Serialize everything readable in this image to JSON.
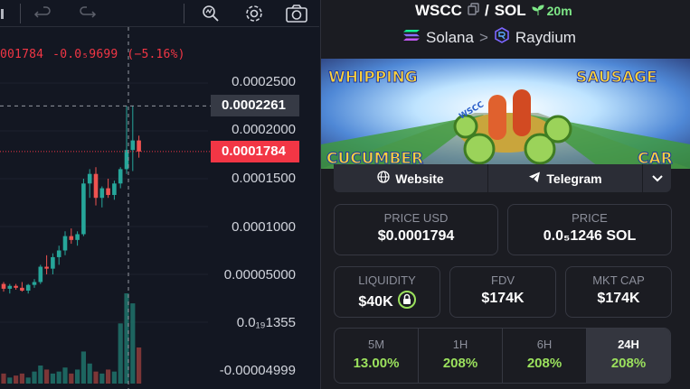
{
  "chart": {
    "toolbar_icons": [
      "bar-chart-icon",
      "undo-icon",
      "redo-icon",
      "magnifier-icon",
      "settings-icon",
      "camera-icon"
    ],
    "price_line": {
      "close": "001784",
      "change": "-0.0₅9699",
      "percent": "(−5.16%)"
    },
    "axis_ticks": [
      "0.0002500",
      "0.0002000",
      "0.0001500",
      "0.0001000",
      "0.00005000",
      "0.0₁₉1355",
      "-0.00004999"
    ],
    "crosshair_value": "0.0002261",
    "current_price": "0.0001784",
    "colors": {
      "up": "#26a69a",
      "down": "#ef5350",
      "current": "#f23645"
    }
  },
  "chart_data": {
    "type": "candlestick",
    "ylim": [
      -4.999e-05,
      0.00025
    ],
    "candles": [
      {
        "o": 4e-05,
        "h": 4.2e-05,
        "l": 3.2e-05,
        "c": 3.5e-05
      },
      {
        "o": 3.5e-05,
        "h": 4e-05,
        "l": 3e-05,
        "c": 3.8e-05
      },
      {
        "o": 3.8e-05,
        "h": 4e-05,
        "l": 3.4e-05,
        "c": 3.6e-05
      },
      {
        "o": 3.6e-05,
        "h": 4.2e-05,
        "l": 3.2e-05,
        "c": 3.3e-05
      },
      {
        "o": 3.3e-05,
        "h": 4e-05,
        "l": 3e-05,
        "c": 3.9e-05
      },
      {
        "o": 3.9e-05,
        "h": 4.5e-05,
        "l": 3.6e-05,
        "c": 4.2e-05
      },
      {
        "o": 4.2e-05,
        "h": 6e-05,
        "l": 4e-05,
        "c": 5.8e-05
      },
      {
        "o": 5.8e-05,
        "h": 7e-05,
        "l": 5e-05,
        "c": 5.6e-05
      },
      {
        "o": 5.6e-05,
        "h": 7.2e-05,
        "l": 5e-05,
        "c": 6.8e-05
      },
      {
        "o": 6.8e-05,
        "h": 8e-05,
        "l": 6e-05,
        "c": 7.5e-05
      },
      {
        "o": 7.5e-05,
        "h": 9.5e-05,
        "l": 7e-05,
        "c": 9e-05
      },
      {
        "o": 9e-05,
        "h": 9.8e-05,
        "l": 8.2e-05,
        "c": 8.6e-05
      },
      {
        "o": 8.6e-05,
        "h": 9.5e-05,
        "l": 8e-05,
        "c": 9.2e-05
      },
      {
        "o": 9.2e-05,
        "h": 0.00015,
        "l": 9e-05,
        "c": 0.000145
      },
      {
        "o": 0.000145,
        "h": 0.00016,
        "l": 0.00013,
        "c": 0.000155
      },
      {
        "o": 0.000155,
        "h": 0.000162,
        "l": 0.000122,
        "c": 0.00013
      },
      {
        "o": 0.00013,
        "h": 0.000142,
        "l": 0.00012,
        "c": 0.00014
      },
      {
        "o": 0.00014,
        "h": 0.00015,
        "l": 0.00013,
        "c": 0.000133
      },
      {
        "o": 0.000133,
        "h": 0.000148,
        "l": 0.000128,
        "c": 0.000145
      },
      {
        "o": 0.000145,
        "h": 0.000162,
        "l": 0.00014,
        "c": 0.00016
      },
      {
        "o": 0.00016,
        "h": 0.0002261,
        "l": 0.000155,
        "c": 0.00018
      },
      {
        "o": 0.00018,
        "h": 0.0002261,
        "l": 0.000158,
        "c": 0.00019
      },
      {
        "o": 0.00019,
        "h": 0.000195,
        "l": 0.000172,
        "c": 0.0001784
      }
    ],
    "volume": [
      5,
      3,
      4,
      5,
      3,
      6,
      9,
      7,
      5,
      6,
      8,
      5,
      7,
      16,
      10,
      6,
      5,
      7,
      6,
      30,
      45,
      40,
      18
    ]
  },
  "pair": {
    "base": "WSCC",
    "slash": "/",
    "quote": "SOL",
    "age": "20m",
    "chain": "Solana",
    "separator": ">",
    "dex": "Raydium"
  },
  "banner": {
    "line1_left": "WHIPPING",
    "line1_right": "SAUSAGE",
    "line2_left": "CUCUMBER",
    "line2_right": "CAR",
    "kart_label": "WSCC"
  },
  "links": {
    "website": "Website",
    "telegram": "Telegram"
  },
  "stats": {
    "price_usd_label": "PRICE USD",
    "price_usd": "$0.0001794",
    "price_label": "PRICE",
    "price_sol": "0.0₅1246 SOL",
    "liquidity_label": "LIQUIDITY",
    "liquidity": "$40K",
    "fdv_label": "FDV",
    "fdv": "$174K",
    "mcap_label": "MKT CAP",
    "mcap": "$174K"
  },
  "timeframes": [
    {
      "label": "5M",
      "value": "13.00%"
    },
    {
      "label": "1H",
      "value": "208%"
    },
    {
      "label": "6H",
      "value": "208%"
    },
    {
      "label": "24H",
      "value": "208%"
    }
  ]
}
